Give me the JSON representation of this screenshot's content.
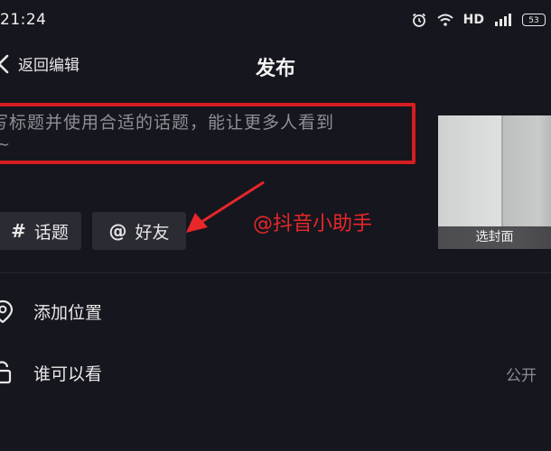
{
  "status_bar": {
    "time": "21:24",
    "network_label": "HD",
    "battery_level": "53"
  },
  "nav": {
    "back_label": "返回编辑",
    "title": "发布"
  },
  "title_input": {
    "placeholder": "写标题并使用合适的话题，能让更多人看到",
    "placeholder_tail": "~"
  },
  "cover": {
    "label": "选封面"
  },
  "chips": {
    "topic_symbol": "#",
    "topic_label": "话题",
    "friend_symbol": "@",
    "friend_label": "好友"
  },
  "annotation": {
    "text": "@抖音小助手",
    "color": "#e8272a"
  },
  "settings": {
    "location_label": "添加位置",
    "visibility_label": "谁可以看",
    "visibility_value": "公开"
  },
  "colors": {
    "background": "#16161e",
    "highlight_border": "#d41e21",
    "chip_background": "#2b2b33"
  },
  "icons": [
    "alarm-icon",
    "wifi-icon",
    "signal-icon",
    "battery-icon",
    "back-chevron-icon",
    "location-pin-icon",
    "lock-icon",
    "red-arrow-icon"
  ]
}
